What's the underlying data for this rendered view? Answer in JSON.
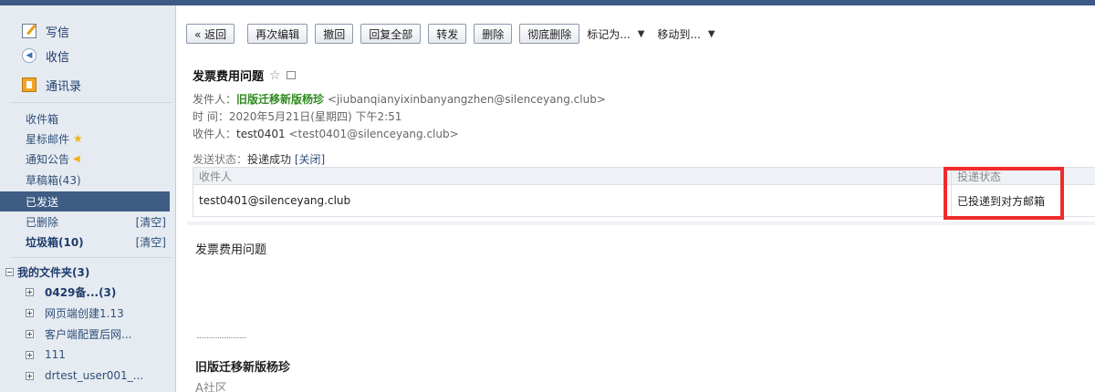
{
  "sidebar": {
    "actions": [
      {
        "label": "写信",
        "icon": "compose-icon"
      },
      {
        "label": "收信",
        "icon": "receive-icon"
      },
      {
        "label": "通讯录",
        "icon": "address-book-icon"
      }
    ],
    "folders": {
      "inbox": "收件箱",
      "starred": "星标邮件",
      "notices": "通知公告",
      "drafts": "草稿箱(43)",
      "sent": "已发送",
      "deleted": "已删除",
      "deleted_clear": "[清空]",
      "junk": "垃圾箱(10)",
      "junk_clear": "[清空]"
    },
    "my_folders": {
      "title": "我的文件夹(3)",
      "items": [
        "0429备...(3)",
        "网页端创建1.13",
        "客户端配置后网...",
        "111",
        "drtest_user001_..."
      ]
    }
  },
  "toolbar": {
    "back": "« 返回",
    "edit_again": "再次编辑",
    "recall": "撤回",
    "reply_all": "回复全部",
    "forward": "转发",
    "delete": "删除",
    "delete_permanently": "彻底删除",
    "mark_as": "标记为...",
    "move_to": "移动到..."
  },
  "mail": {
    "subject": "发票费用问题",
    "from_label": "发件人：",
    "from_name": "旧版迁移新版杨珍",
    "from_email": "<jiubanqianyixinbanyangzhen@silenceyang.club>",
    "time_label": "时  间：",
    "time_value": "2020年5月21日(星期四) 下午2:51",
    "to_label": "收件人：",
    "to_name": "test0401",
    "to_email": "<test0401@silenceyang.club>",
    "status_label": "发送状态：",
    "status_value": "投递成功",
    "status_close": "[关闭]",
    "table": {
      "headers": [
        "收件人",
        "投递状态"
      ],
      "rows": [
        [
          "test0401@silenceyang.club",
          "已投递到对方邮箱"
        ]
      ]
    },
    "body": "发票费用问题",
    "signature_name": "旧版迁移新版杨珍",
    "signature_org": "A社区"
  },
  "colors": {
    "accent": "#3e5c84",
    "highlight": "#ef2b2b",
    "sender": "#2e8b1f"
  }
}
